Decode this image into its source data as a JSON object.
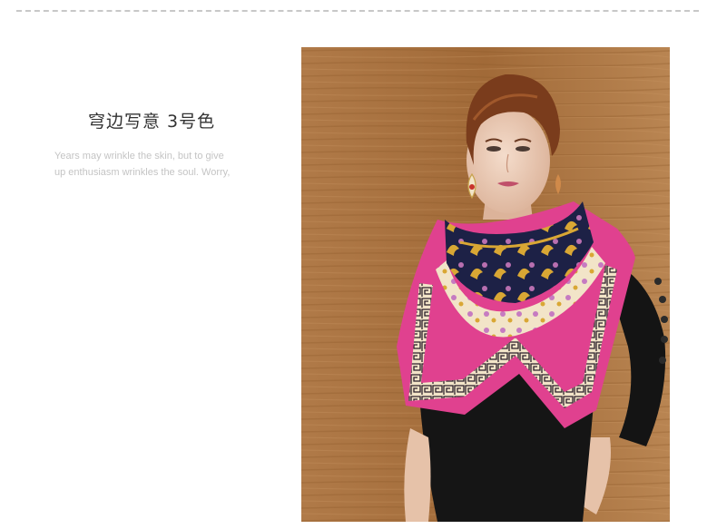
{
  "product": {
    "title": "穹边写意  3号色",
    "quote_line_1": "Years may wrinkle the skin, but to give",
    "quote_line_2": "up enthusiasm wrinkles the soul. Worry,"
  },
  "photo": {
    "subject": "model-wearing-scarf",
    "colors": {
      "wood_background": "#a8703f",
      "scarf_navy": "#1d2146",
      "scarf_gold": "#d9a734",
      "scarf_pink": "#e0418f",
      "scarf_cream": "#f2e4c8",
      "dress_black": "#151515",
      "skin": "#eac9b4",
      "hair": "#7a3c1c"
    }
  }
}
